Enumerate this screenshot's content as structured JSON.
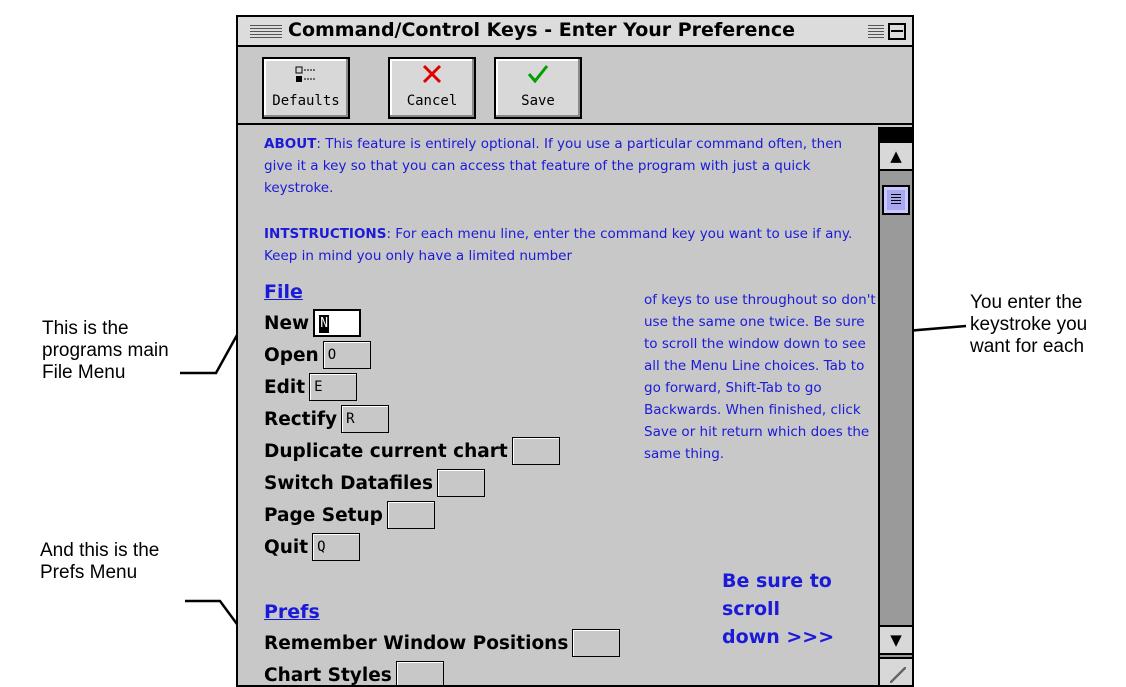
{
  "callouts": {
    "file_menu": "This is the\nprograms main\nFile Menu",
    "prefs_menu": "And this is the\nPrefs Menu",
    "keystroke": "You enter the\nkeystroke you\nwant for each"
  },
  "window": {
    "title": "Command/Control Keys - Enter Your Preference"
  },
  "toolbar": {
    "defaults_label": "Defaults",
    "cancel_label": "Cancel",
    "save_label": "Save"
  },
  "about": {
    "heading": "ABOUT",
    "text": ": This feature is entirely optional.  If you use a particular command often, then give it a key so that you can access that feature of the program with just a quick keystroke."
  },
  "instructions": {
    "heading": "INTSTRUCTIONS",
    "text": ": For each menu line, enter the command key you want to use if any.  Keep in mind you only have a limited number",
    "continued": "of keys to use throughout so don't use the same one twice.  Be sure to scroll the window down to see all the Menu Line choices. Tab to go forward, Shift-Tab to go Backwards. When finished, click Save or hit return which does the same thing."
  },
  "file_section": {
    "heading": "File",
    "items": [
      {
        "label": "New",
        "value": ""
      },
      {
        "label": "Open",
        "value": "O"
      },
      {
        "label": "Edit",
        "value": "E"
      },
      {
        "label": "Rectify",
        "value": "R"
      },
      {
        "label": "Duplicate current chart",
        "value": ""
      },
      {
        "label": "Switch Datafiles",
        "value": ""
      },
      {
        "label": "Page Setup",
        "value": ""
      },
      {
        "label": "Quit",
        "value": "Q"
      }
    ]
  },
  "prefs_section": {
    "heading": "Prefs",
    "items": [
      {
        "label": "Remember Window Positions",
        "value": ""
      },
      {
        "label": "Chart Styles",
        "value": ""
      }
    ]
  },
  "scroll_note": "Be sure to\nscroll\ndown  >>>",
  "colors": {
    "accent": "#1a1ad8",
    "window_bg": "#c8c8c8"
  }
}
